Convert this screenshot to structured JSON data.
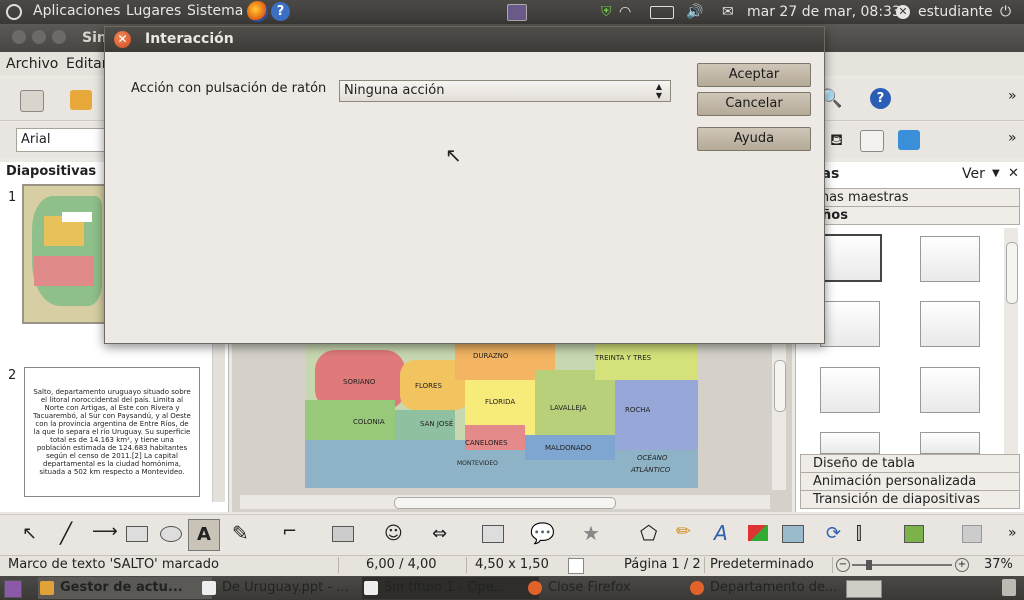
{
  "top_panel": {
    "menus": [
      "Aplicaciones",
      "Lugares",
      "Sistema"
    ],
    "clock": "mar 27 de mar, 08:33",
    "user": "estudiante"
  },
  "background_window": {
    "title": "Sin",
    "menus": [
      "Archivo",
      "Editar"
    ],
    "font_name": "Arial",
    "slides_pane_title": "Diapositivas",
    "slide_numbers": [
      "1",
      "2"
    ],
    "slide2_text": "Salto, departamento uruguayo situado sobre el litoral noroccidental del país. Limita al Norte con Artigas, al Este con Rivera y Tacuarembó, al Sur con Paysandú, y al Oeste con la provincia argentina de Entre Ríos, de la que lo separa el río Uruguay. Su superficie total es de 14.163 km², y tiene una población estimada de 124.683 habitantes según el censo de 2011.[2] La capital departamental es la ciudad homónima, situada a 502 km respecto a Montevideo.",
    "tasks_pane": {
      "title": "eas",
      "view_label": "Ver",
      "sections_top": [
        "áginas maestras",
        "iseños"
      ],
      "sections_bottom": [
        "Diseño de tabla",
        "Animación personalizada",
        "Transición de diapositivas"
      ]
    },
    "map_labels": [
      "DURAZNO",
      "TREINTA Y TRES",
      "SORIANO",
      "FLORES",
      "FLORIDA",
      "LAVALLEJA",
      "ROCHA",
      "COLONIA",
      "SAN JOSÉ",
      "CANELONES",
      "MALDONADO",
      "MONTEVIDEO",
      "OCÉANO",
      "ATLÁNTICO"
    ],
    "status": {
      "message": "Marco de texto 'SALTO' marcado",
      "position": "6,00 / 4,00",
      "size": "4,50 x 1,50",
      "page": "Página 1 / 2",
      "layout": "Predeterminado",
      "zoom": "37%"
    }
  },
  "dialog": {
    "title": "Interacción",
    "field_label": "Acción con pulsación de ratón",
    "select_value": "Ninguna acción",
    "ok": "Aceptar",
    "cancel": "Cancelar",
    "help": "Ayuda"
  },
  "taskbar": {
    "tasks": [
      "Gestor de actu...",
      "De Uruguay.ppt - ...",
      "Sin título 1 - Ope...",
      "Close Firefox",
      "Departamento de..."
    ]
  },
  "colors": {
    "panel": "#3f3e3b",
    "dialog_bg": "#edeae5",
    "button": "#c2b8a8",
    "close_orange": "#e0622f"
  }
}
